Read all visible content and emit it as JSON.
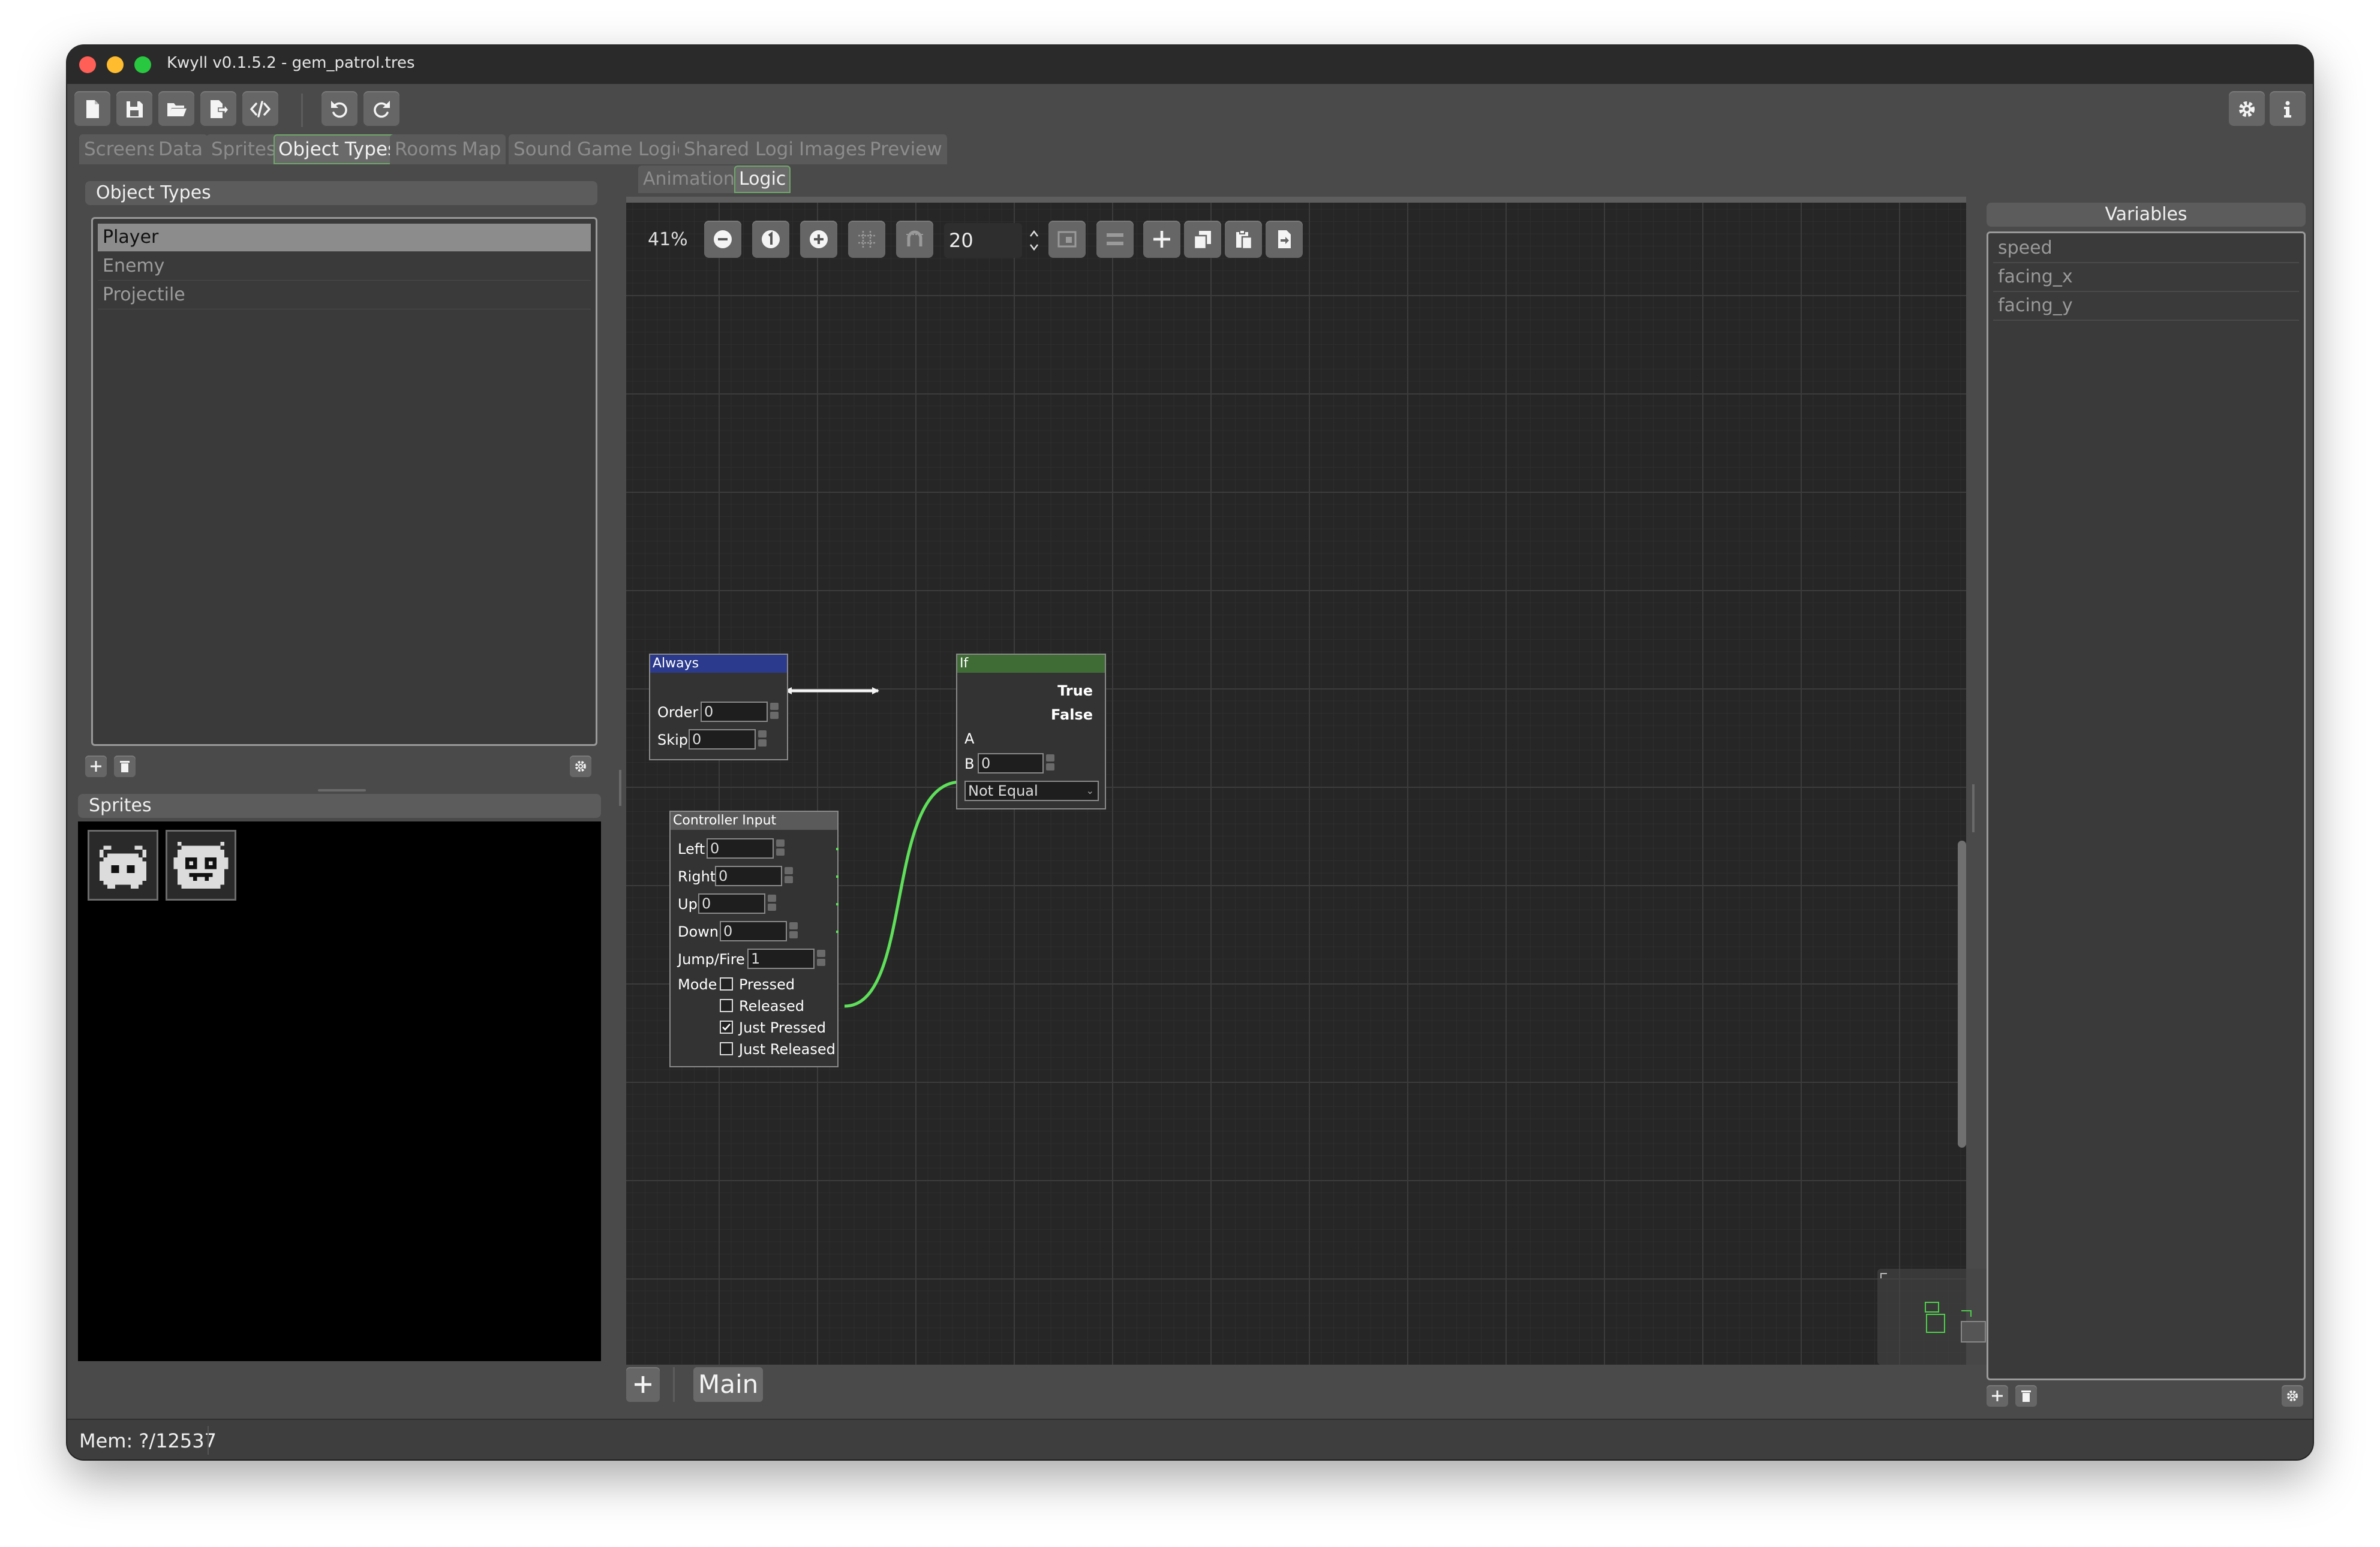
{
  "window": {
    "title": "Kwyll v0.1.5.2 - gem_patrol.tres"
  },
  "colors": {
    "accent_green": "#6fa86a",
    "wire_green": "#5fe05a",
    "always_header": "#2b3a8c",
    "if_header": "#3f6b35"
  },
  "main_tabs": [
    {
      "label": "Screens"
    },
    {
      "label": "Data"
    },
    {
      "label": "Sprites"
    },
    {
      "label": "Object Types"
    },
    {
      "label": "Rooms"
    },
    {
      "label": "Map"
    },
    {
      "label": "Sound"
    },
    {
      "label": "Game Logic"
    },
    {
      "label": "Shared Logic"
    },
    {
      "label": "Images"
    },
    {
      "label": "Preview"
    }
  ],
  "active_main_tab": "Object Types",
  "object_types": {
    "title": "Object Types",
    "items": [
      "Player",
      "Enemy",
      "Projectile"
    ],
    "selected": "Player"
  },
  "sprites": {
    "title": "Sprites",
    "count": 2
  },
  "sub_tabs": [
    {
      "label": "Animation"
    },
    {
      "label": "Logic"
    }
  ],
  "active_sub_tab": "Logic",
  "canvas_toolbar": {
    "zoom": "41%",
    "snap_value": "20"
  },
  "nodes": {
    "always": {
      "title": "Always",
      "order_label": "Order",
      "order_value": "0",
      "skip_label": "Skip",
      "skip_value": "0"
    },
    "if": {
      "title": "If",
      "true_label": "True",
      "false_label": "False",
      "a_label": "A",
      "b_label": "B",
      "b_value": "0",
      "op": "Not Equal"
    },
    "controller": {
      "title": "Controller Input",
      "left_label": "Left",
      "left_value": "0",
      "right_label": "Right",
      "right_value": "0",
      "up_label": "Up",
      "up_value": "0",
      "down_label": "Down",
      "down_value": "0",
      "jump_label": "Jump/Fire",
      "jump_value": "1",
      "mode_label": "Mode",
      "modes": [
        {
          "label": "Pressed",
          "checked": false
        },
        {
          "label": "Released",
          "checked": false
        },
        {
          "label": "Just Pressed",
          "checked": true
        },
        {
          "label": "Just Released",
          "checked": false
        }
      ]
    }
  },
  "graph_tabs": [
    {
      "label": "Main"
    }
  ],
  "variables": {
    "title": "Variables",
    "items": [
      "speed",
      "facing_x",
      "facing_y"
    ]
  },
  "status_bar": {
    "mem": "Mem: ?/12537"
  }
}
